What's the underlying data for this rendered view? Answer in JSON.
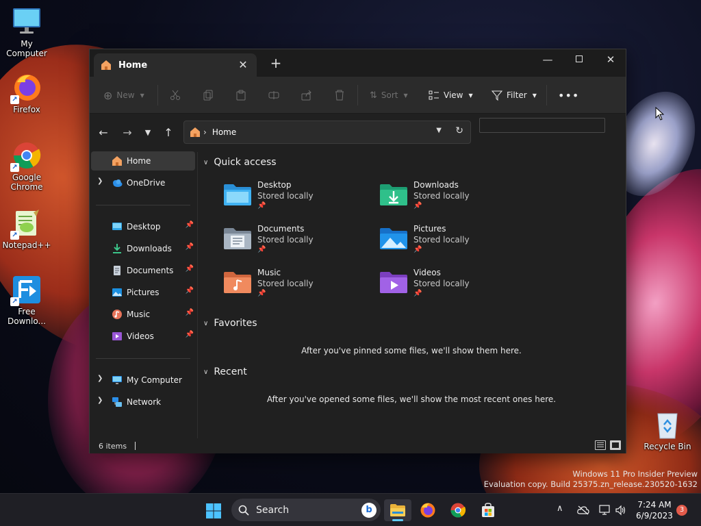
{
  "desktop": {
    "icons": [
      {
        "label": "My Computer"
      },
      {
        "label": "Firefox"
      },
      {
        "label": "Google Chrome"
      },
      {
        "label": "Notepad++"
      },
      {
        "label": "Free Downlo..."
      },
      {
        "label": "Recycle Bin"
      }
    ],
    "watermark_line1": "Windows 11 Pro Insider Preview",
    "watermark_line2": "Evaluation copy. Build 25375.zn_release.230520-1632"
  },
  "explorer": {
    "tab_title": "Home",
    "toolbar": {
      "new_label": "New",
      "sort_label": "Sort",
      "view_label": "View",
      "filter_label": "Filter"
    },
    "address": {
      "path_label": "Home",
      "search_placeholder": ""
    },
    "nav": {
      "home": "Home",
      "onedrive": "OneDrive",
      "pinned": [
        {
          "label": "Desktop"
        },
        {
          "label": "Downloads"
        },
        {
          "label": "Documents"
        },
        {
          "label": "Pictures"
        },
        {
          "label": "Music"
        },
        {
          "label": "Videos"
        }
      ],
      "my_computer": "My Computer",
      "network": "Network"
    },
    "quick_access": {
      "header": "Quick access",
      "items": [
        {
          "name": "Desktop",
          "sub": "Stored locally"
        },
        {
          "name": "Downloads",
          "sub": "Stored locally"
        },
        {
          "name": "Documents",
          "sub": "Stored locally"
        },
        {
          "name": "Pictures",
          "sub": "Stored locally"
        },
        {
          "name": "Music",
          "sub": "Stored locally"
        },
        {
          "name": "Videos",
          "sub": "Stored locally"
        }
      ]
    },
    "favorites": {
      "header": "Favorites",
      "empty": "After you've pinned some files, we'll show them here."
    },
    "recent": {
      "header": "Recent",
      "empty": "After you've opened some files, we'll show the most recent ones here."
    },
    "status": {
      "count": "6 items"
    }
  },
  "taskbar": {
    "search_label": "Search",
    "time": "7:24 AM",
    "date": "6/9/2023",
    "notifications": "3"
  },
  "colors": {
    "accent": "#60cdff",
    "window_bg": "#202020",
    "toolbar_bg": "#2b2b2b",
    "taskbar_bg": "#1f1f25"
  }
}
